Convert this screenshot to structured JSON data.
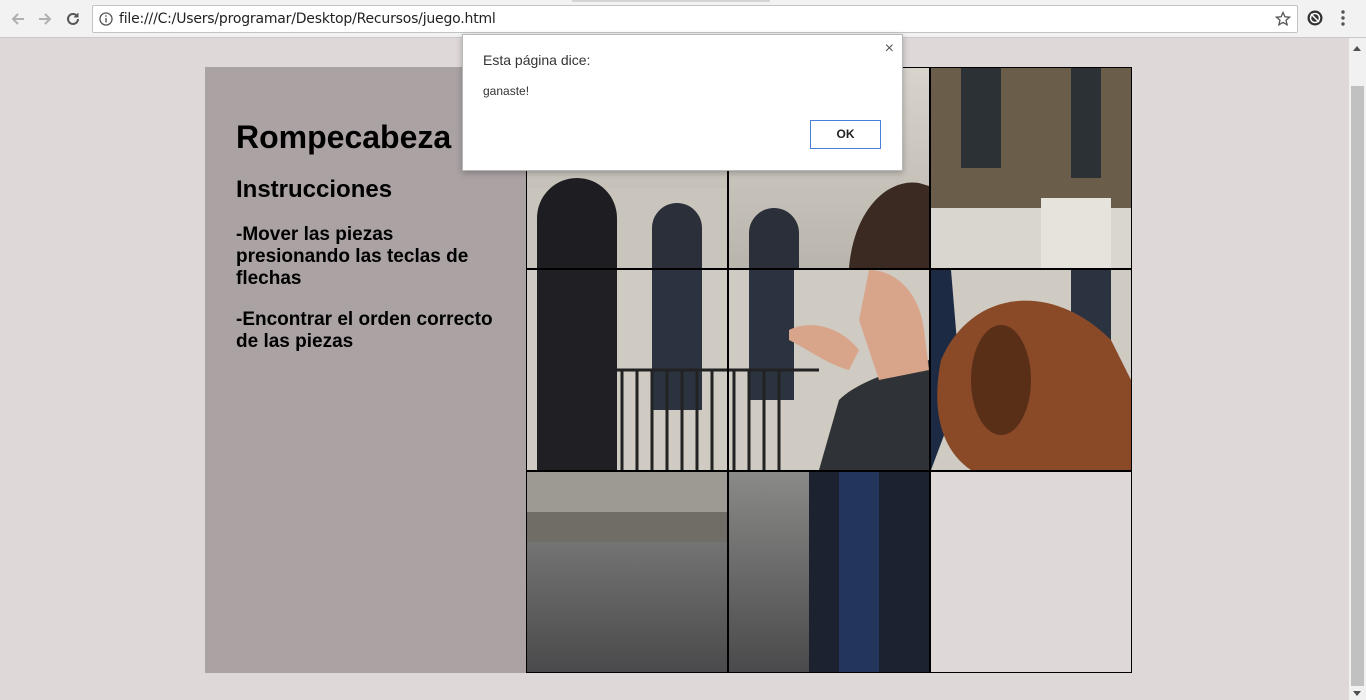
{
  "browser": {
    "url": "file:///C:/Users/programar/Desktop/Recursos/juego.html",
    "back_icon": "arrow-left",
    "forward_icon": "arrow-right",
    "reload_icon": "reload",
    "info_icon": "info-circle",
    "star_icon": "star-outline",
    "menu_icon": "vertical-dots"
  },
  "page": {
    "title": "Rompecabeza",
    "subtitle": "Instrucciones",
    "instructions": [
      "-Mover las piezas presionando las teclas de flechas",
      "-Encontrar el orden correcto de las piezas"
    ],
    "colors": {
      "page_bg": "#ded8d8",
      "panel_bg": "#aaa2a3"
    }
  },
  "puzzle": {
    "rows": 3,
    "cols": 3,
    "empty_cell": "bottom-right"
  },
  "dialog": {
    "title": "Esta página dice:",
    "message": "ganaste!",
    "ok_label": "OK",
    "close_label": "×"
  }
}
